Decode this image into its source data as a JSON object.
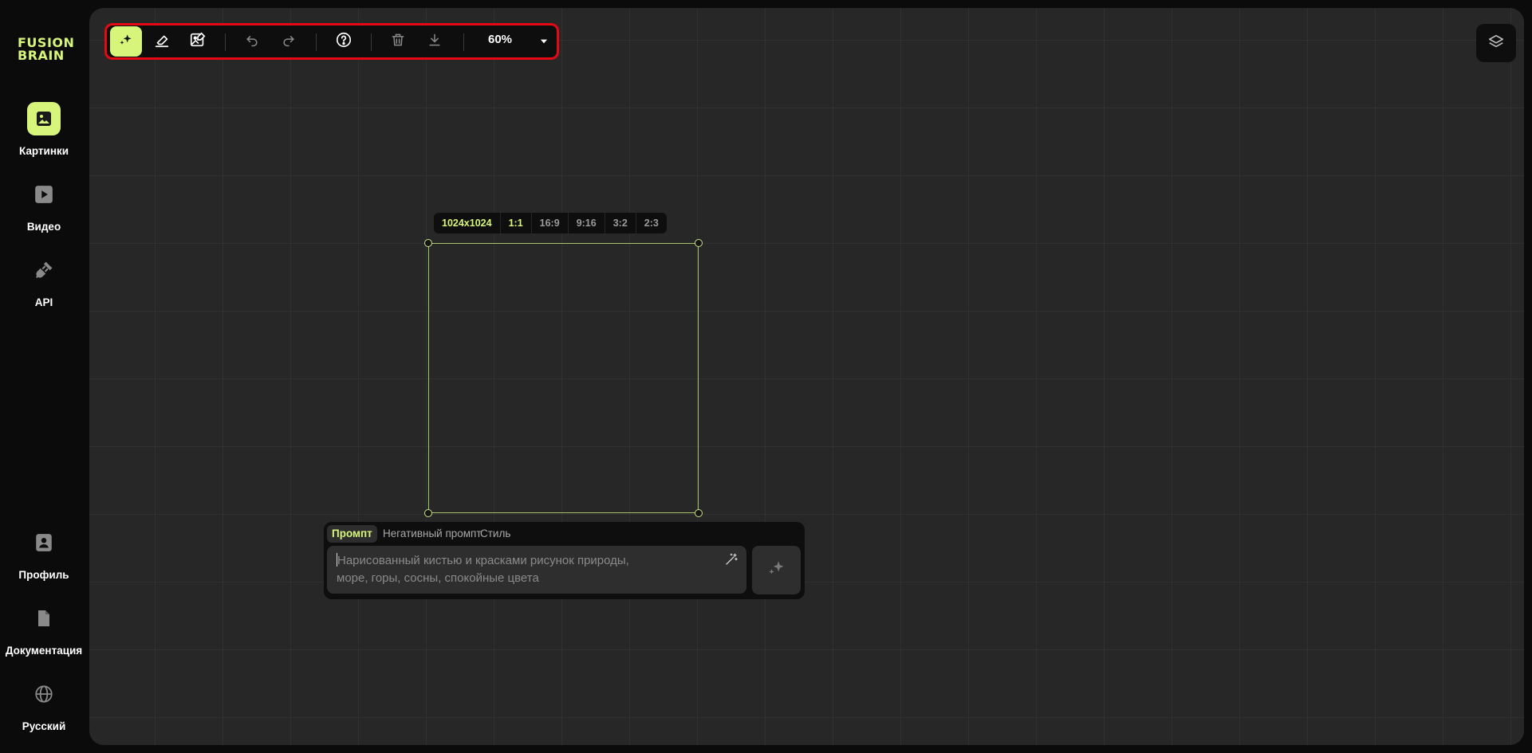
{
  "app": {
    "logo_line1": "FUSION",
    "logo_line2": "BRAIN",
    "accent_color": "#d7f57a",
    "highlight_color": "#e50914"
  },
  "sidebar": {
    "items": [
      {
        "label": "Картинки",
        "icon": "image-icon",
        "active": true
      },
      {
        "label": "Видео",
        "icon": "play-icon",
        "active": false
      },
      {
        "label": "API",
        "icon": "plug-icon",
        "active": false
      },
      {
        "label": "Профиль",
        "icon": "profile-icon",
        "active": false
      },
      {
        "label": "Документация",
        "icon": "document-icon",
        "active": false
      },
      {
        "label": "Русский",
        "icon": "globe-icon",
        "active": false
      }
    ]
  },
  "toolbar": {
    "tools": [
      "sparkle-icon",
      "eraser-icon",
      "image-edit-icon",
      "undo-icon",
      "redo-icon",
      "help-icon",
      "trash-icon",
      "download-icon"
    ],
    "active_tool": "sparkle-icon",
    "zoom": "60%"
  },
  "canvas": {
    "size_label": "1024x1024",
    "ratios": [
      "1:1",
      "16:9",
      "9:16",
      "3:2",
      "2:3"
    ],
    "selected_ratio": "1:1"
  },
  "prompt": {
    "tabs": [
      "Промпт",
      "Негативный промпт",
      "Стиль"
    ],
    "active_tab": "Промпт",
    "placeholder_line1": "Нарисованный кистью и красками рисунок природы,",
    "placeholder_line2": "море, горы, сосны, спокойные цвета"
  }
}
